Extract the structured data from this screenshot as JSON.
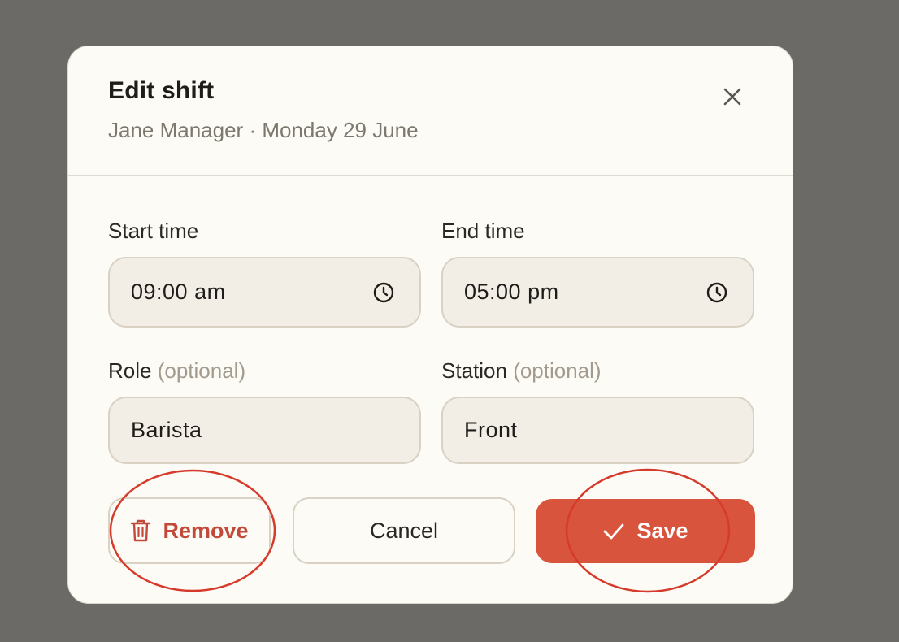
{
  "dialog": {
    "title": "Edit shift",
    "subtitle": "Jane Manager · Monday 29 June",
    "close_icon": "close-icon"
  },
  "fields": {
    "start_time": {
      "label": "Start time",
      "value": "09:00 am",
      "icon": "clock-icon"
    },
    "end_time": {
      "label": "End time",
      "value": "05:00 pm",
      "icon": "clock-icon"
    },
    "role": {
      "label": "Role",
      "optional": "(optional)",
      "value": "Barista"
    },
    "station": {
      "label": "Station",
      "optional": "(optional)",
      "value": "Front"
    }
  },
  "actions": {
    "remove_label": "Remove",
    "remove_icon": "trash-icon",
    "cancel_label": "Cancel",
    "save_label": "Save",
    "save_icon": "check-icon"
  },
  "colors": {
    "backdrop": "#6b6a67",
    "surface": "#fdfbf6",
    "accent": "#d9543c",
    "danger_text": "#c24a3a",
    "annotation": "#d63a2a"
  }
}
